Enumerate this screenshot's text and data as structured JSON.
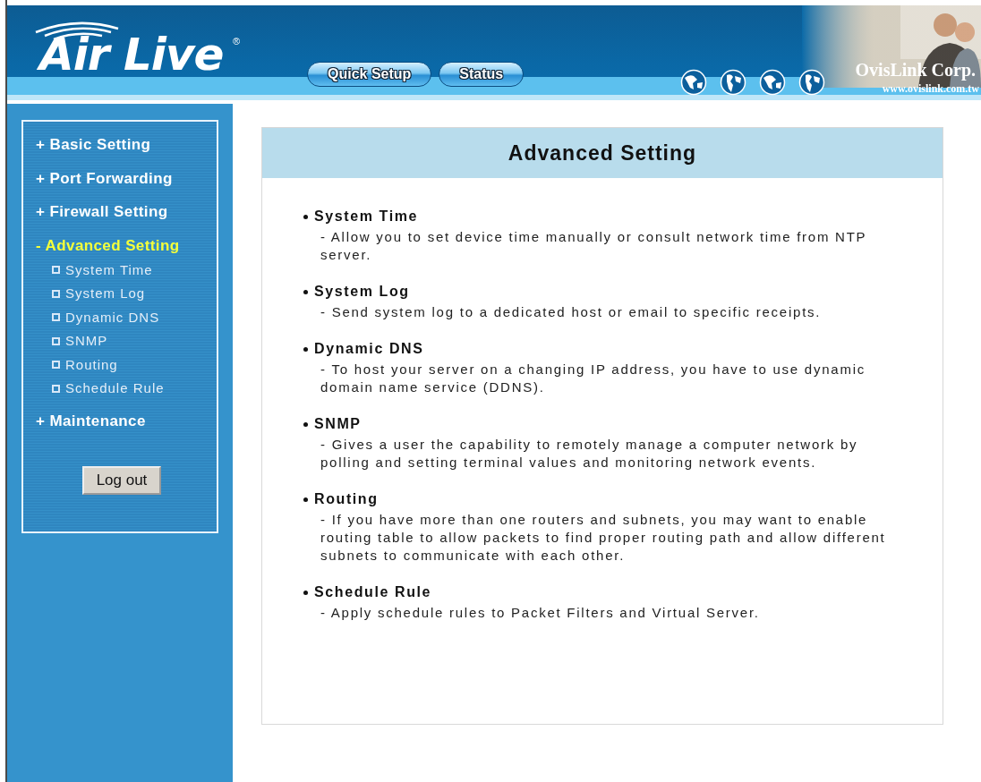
{
  "header": {
    "logo": "Air Live",
    "registered_mark": "®",
    "nav_buttons": [
      "Quick Setup",
      "Status"
    ],
    "company": "OvisLink Corp.",
    "website": "www.ovislink.com.tw"
  },
  "sidebar": {
    "items": [
      {
        "marker": "+",
        "label": "Basic Setting",
        "expanded": false
      },
      {
        "marker": "+",
        "label": "Port Forwarding",
        "expanded": false
      },
      {
        "marker": "+",
        "label": "Firewall Setting",
        "expanded": false
      },
      {
        "marker": "-",
        "label": "Advanced Setting",
        "expanded": true,
        "children": [
          {
            "label": "System Time"
          },
          {
            "label": "System Log"
          },
          {
            "label": "Dynamic DNS"
          },
          {
            "label": "SNMP"
          },
          {
            "label": "Routing"
          },
          {
            "label": "Schedule Rule"
          }
        ]
      },
      {
        "marker": "+",
        "label": "Maintenance",
        "expanded": false
      }
    ],
    "logout_button": "Log out"
  },
  "content": {
    "title": "Advanced Setting",
    "sections": [
      {
        "title": "System Time",
        "description": "- Allow you to set device time manually or consult network time from NTP server."
      },
      {
        "title": "System Log",
        "description": "- Send system log to a dedicated host or email to specific receipts."
      },
      {
        "title": "Dynamic DNS",
        "description": "- To host your server on a changing IP address, you have to use dynamic domain name service (DDNS)."
      },
      {
        "title": "SNMP",
        "description": "- Gives a user the capability to remotely manage a computer network by polling and setting terminal values and monitoring network events."
      },
      {
        "title": "Routing",
        "description": "- If you have more than one routers and subnets, you may want to enable routing table to allow packets to find proper routing path and allow different subnets to communicate with each other."
      },
      {
        "title": "Schedule Rule",
        "description": "- Apply schedule rules to Packet Filters and Virtual Server."
      }
    ]
  }
}
